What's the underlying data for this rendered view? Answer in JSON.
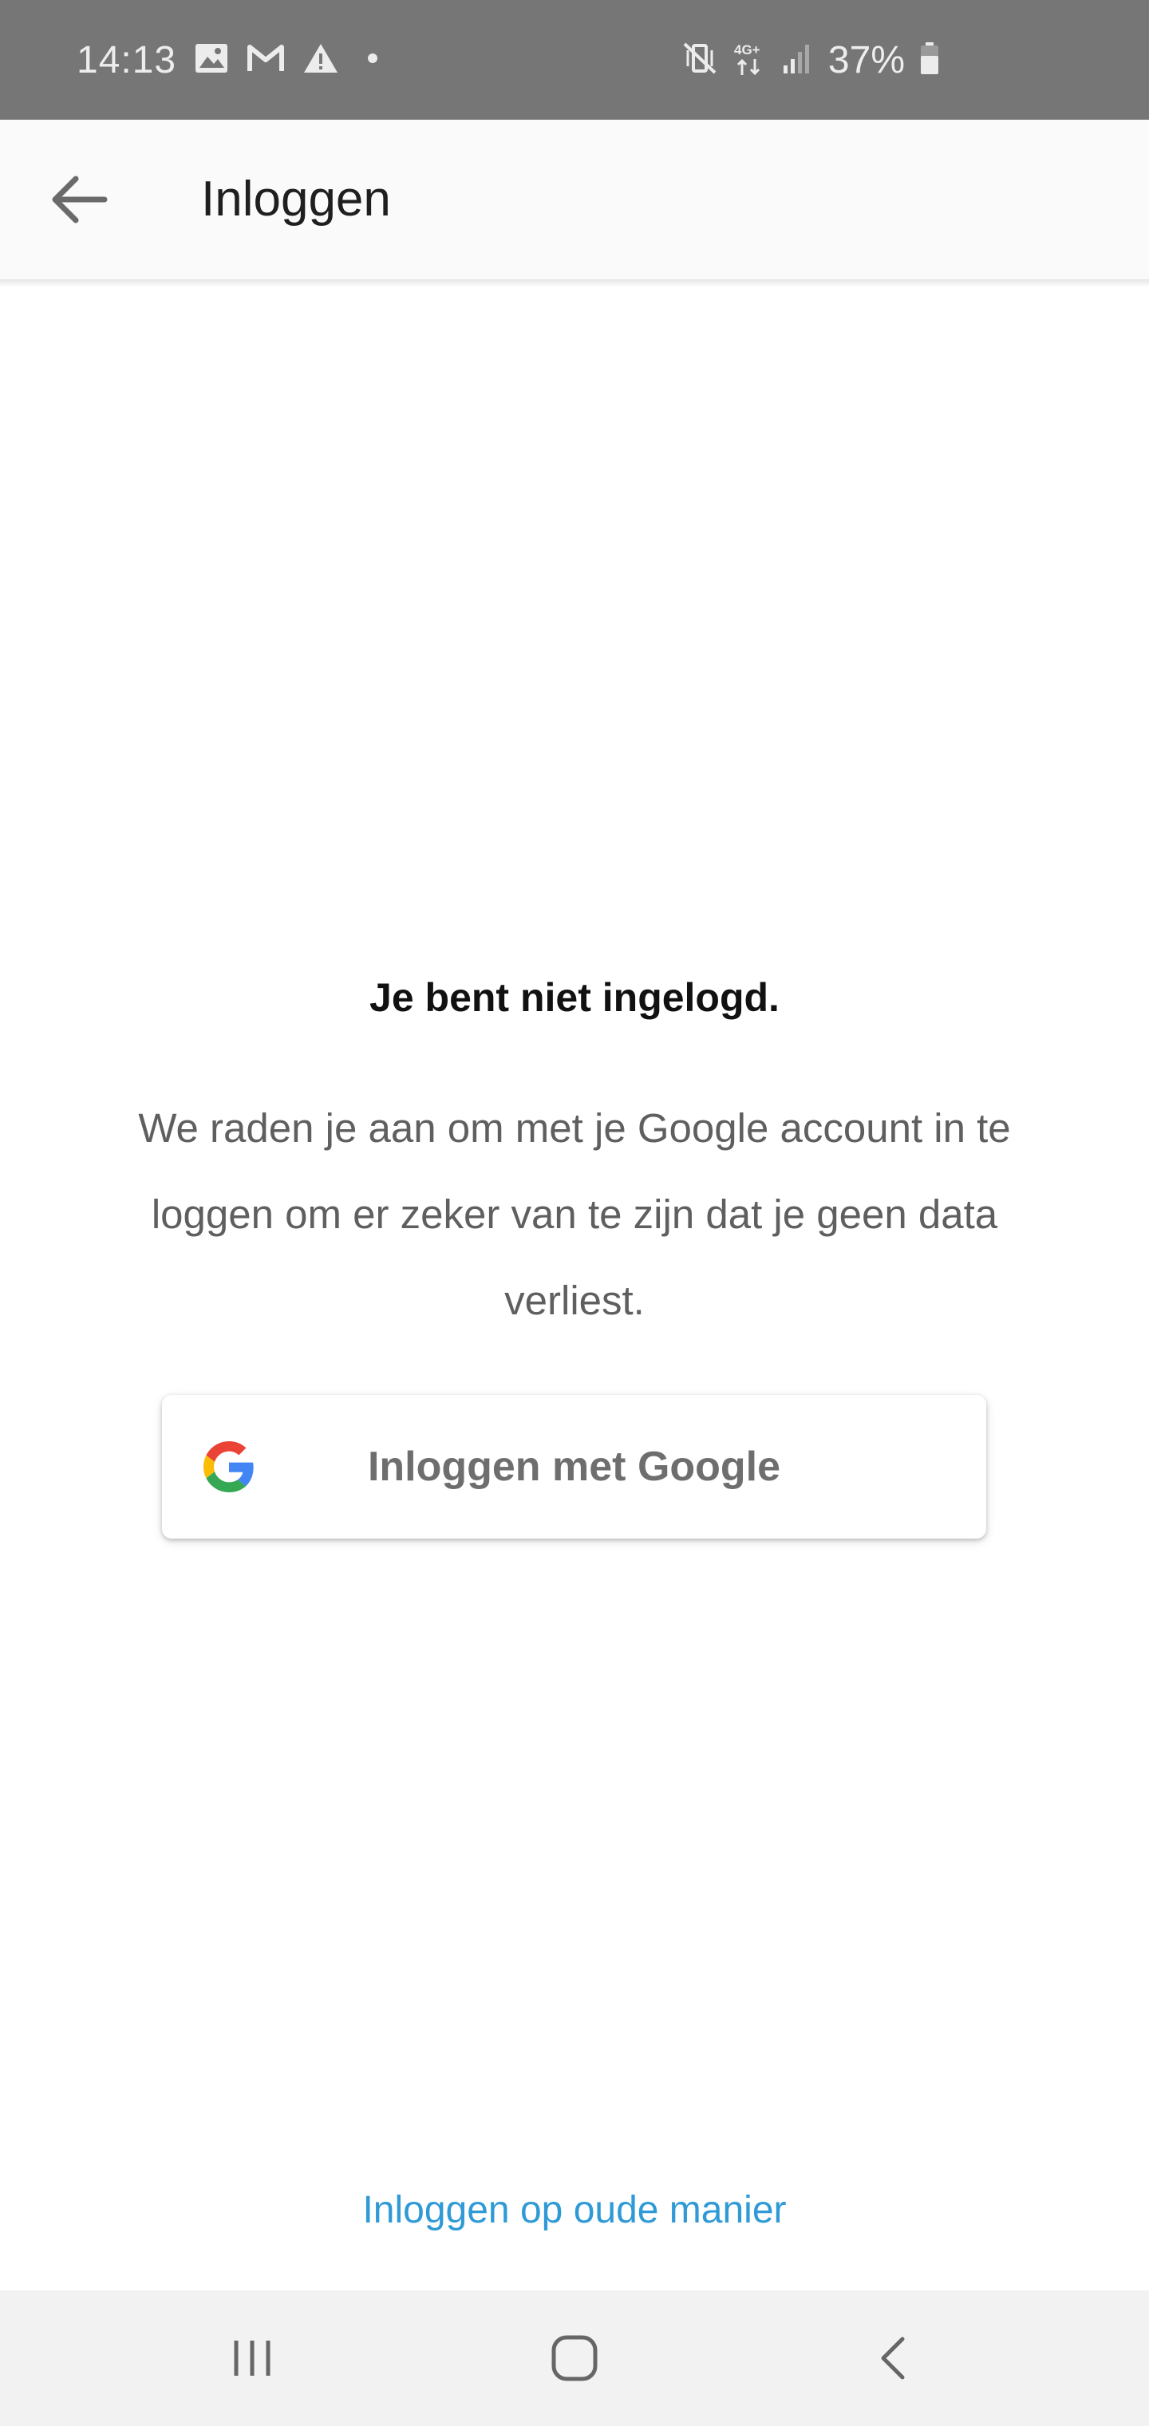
{
  "status_bar": {
    "time": "14:13",
    "notification_icons": [
      "image-icon",
      "gmail-icon",
      "warning-icon",
      "dot-icon"
    ],
    "system_icons": [
      "vibrate-mute-icon",
      "4g-plus-icon",
      "signal-icon",
      "battery-icon"
    ],
    "network_label": "4G+",
    "battery_percent": "37%"
  },
  "app_bar": {
    "title": "Inloggen",
    "back_icon": "arrow-left-icon"
  },
  "main": {
    "heading": "Je bent niet ingelogd.",
    "body": "We raden je aan om met je Google account in te loggen om er zeker van te zijn dat je geen data verliest.",
    "google_button_label": "Inloggen met Google",
    "google_button_icon": "google-g-icon",
    "old_login_link": "Inloggen op oude manier"
  },
  "colors": {
    "status_bar_bg": "#767676",
    "app_bar_bg": "#fafafa",
    "link": "#2f9ad6",
    "nav_bar_bg": "#f2f2f2"
  },
  "nav_bar": {
    "buttons": [
      "recents-icon",
      "home-icon",
      "back-chevron-icon"
    ]
  }
}
